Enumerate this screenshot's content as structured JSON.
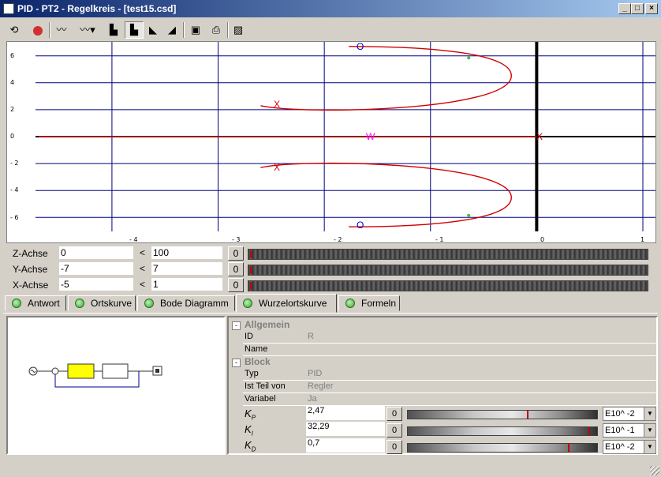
{
  "window": {
    "title": "PID - PT2 - Regelkreis - [test15.csd]"
  },
  "toolbar": {
    "icons": [
      "refresh-icon",
      "stop-icon",
      "noise-icon",
      "signal-menu-icon",
      "step-icon-1",
      "step-icon-2",
      "step-icon-3",
      "step-icon-4",
      "image-icon",
      "print-icon",
      "help-icon"
    ]
  },
  "plot": {
    "y_ticks": [
      "6",
      "4",
      "2",
      "0",
      "- 2",
      "- 4",
      "- 6"
    ],
    "x_ticks": [
      "- 4",
      "- 3",
      "- 2",
      "- 1",
      "0",
      "1"
    ],
    "markers": {
      "zero": "O",
      "pole": "X",
      "w": "W"
    },
    "colors": {
      "locus": "#d00000",
      "marker_zero": "#0000c0",
      "w": "#ff00ff"
    }
  },
  "chart_data": {
    "type": "scatter",
    "title": "",
    "xlabel": "",
    "ylabel": "",
    "xlim": [
      -5,
      1
    ],
    "ylim": [
      -7,
      7
    ],
    "grid": true,
    "series": [
      {
        "name": "",
        "values": []
      }
    ],
    "zeros": [
      [
        -1.77,
        6.7
      ],
      [
        -1.77,
        -6.7
      ]
    ],
    "poles": [
      [
        -2.6,
        2.3
      ],
      [
        -2.6,
        -2.3
      ],
      [
        0,
        0
      ]
    ],
    "w_point": [
      -1.68,
      0
    ]
  },
  "axes": {
    "z": {
      "label": "Z-Achse",
      "min": "0",
      "lt": "<",
      "max": "100",
      "btn": "0"
    },
    "y": {
      "label": "Y-Achse",
      "min": "-7",
      "lt": "<",
      "max": "7",
      "btn": "0"
    },
    "x": {
      "label": "X-Achse",
      "min": "-5",
      "lt": "<",
      "max": "1",
      "btn": "0"
    }
  },
  "tabs": [
    {
      "label": "Antwort"
    },
    {
      "label": "Ortskurve"
    },
    {
      "label": "Bode Diagramm"
    },
    {
      "label": "Wurzelortskurve"
    },
    {
      "label": "Formeln"
    }
  ],
  "props": {
    "allgemein": {
      "heading": "Allgemein",
      "id_label": "ID",
      "id_value": "R",
      "name_label": "Name",
      "name_value": ""
    },
    "block": {
      "heading": "Block",
      "typ_label": "Typ",
      "typ_value": "PID",
      "teil_label": "Ist Teil von",
      "teil_value": "Regler",
      "var_label": "Variabel",
      "var_value": "Ja"
    },
    "params": [
      {
        "sym": "K",
        "sub": "P",
        "value": "2,47",
        "btn": "0",
        "exp": "E10^ -2",
        "level": 0.64
      },
      {
        "sym": "K",
        "sub": "I",
        "value": "32,29",
        "btn": "0",
        "exp": "E10^ -1",
        "level": 0.97
      },
      {
        "sym": "K",
        "sub": "D",
        "value": "0,7",
        "btn": "0",
        "exp": "E10^ -2",
        "level": 0.86
      }
    ]
  }
}
